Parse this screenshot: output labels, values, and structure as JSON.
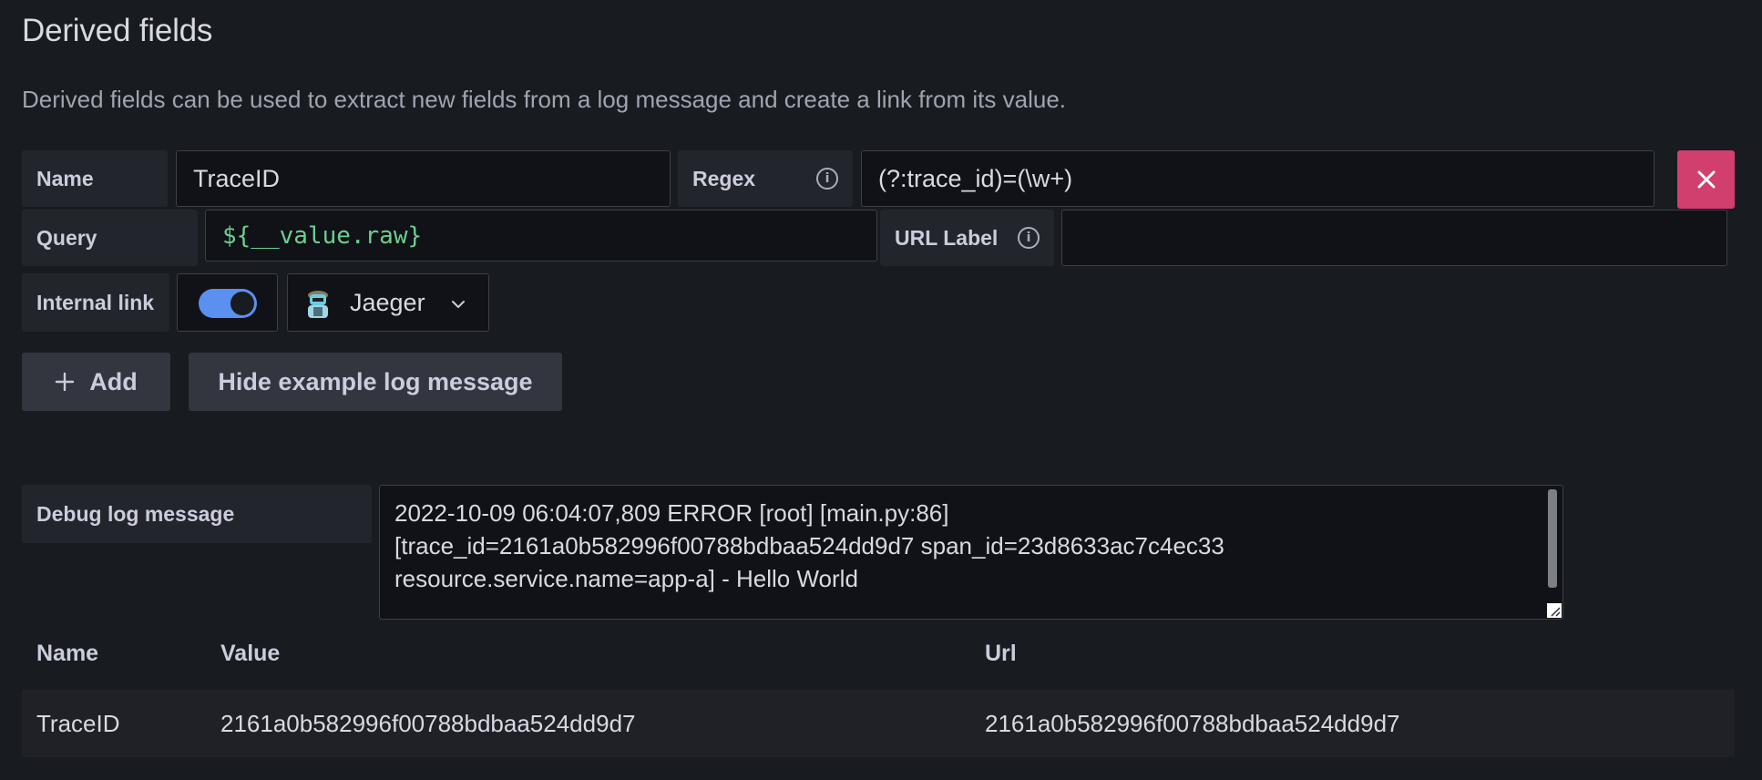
{
  "section": {
    "title": "Derived fields",
    "description": "Derived fields can be used to extract new fields from a log message and create a link from its value."
  },
  "field": {
    "name_label": "Name",
    "name_value": "TraceID",
    "regex_label": "Regex",
    "regex_value": "(?:trace_id)=(\\w+)",
    "query_label": "Query",
    "query_value": "${__value.raw}",
    "url_label_label": "URL Label",
    "url_label_value": "",
    "internal_link_label": "Internal link",
    "internal_link_enabled": true,
    "datasource": "Jaeger"
  },
  "actions": {
    "add_label": "Add",
    "hide_example_label": "Hide example log message"
  },
  "debug": {
    "label": "Debug log message",
    "message_lines": [
      "2022-10-09 06:04:07,809 ERROR [root] [main.py:86]",
      "[trace_id=2161a0b582996f00788bdbaa524dd9d7 span_id=23d8633ac7c4ec33",
      "resource.service.name=app-a] - Hello World"
    ]
  },
  "results": {
    "columns": [
      "Name",
      "Value",
      "Url"
    ],
    "rows": [
      [
        "TraceID",
        "2161a0b582996f00788bdbaa524dd9d7",
        "2161a0b582996f00788bdbaa524dd9d7"
      ]
    ]
  },
  "colors": {
    "background": "#181b1f",
    "remove_button": "#d13f6f",
    "toggle_on": "#5b8ff0",
    "query_text": "#6ccf8e"
  },
  "icons": {
    "remove": "close-icon",
    "info": "info-circle-icon",
    "add": "plus-icon",
    "dropdown": "chevron-down-icon",
    "datasource": "jaeger-logo-icon"
  }
}
